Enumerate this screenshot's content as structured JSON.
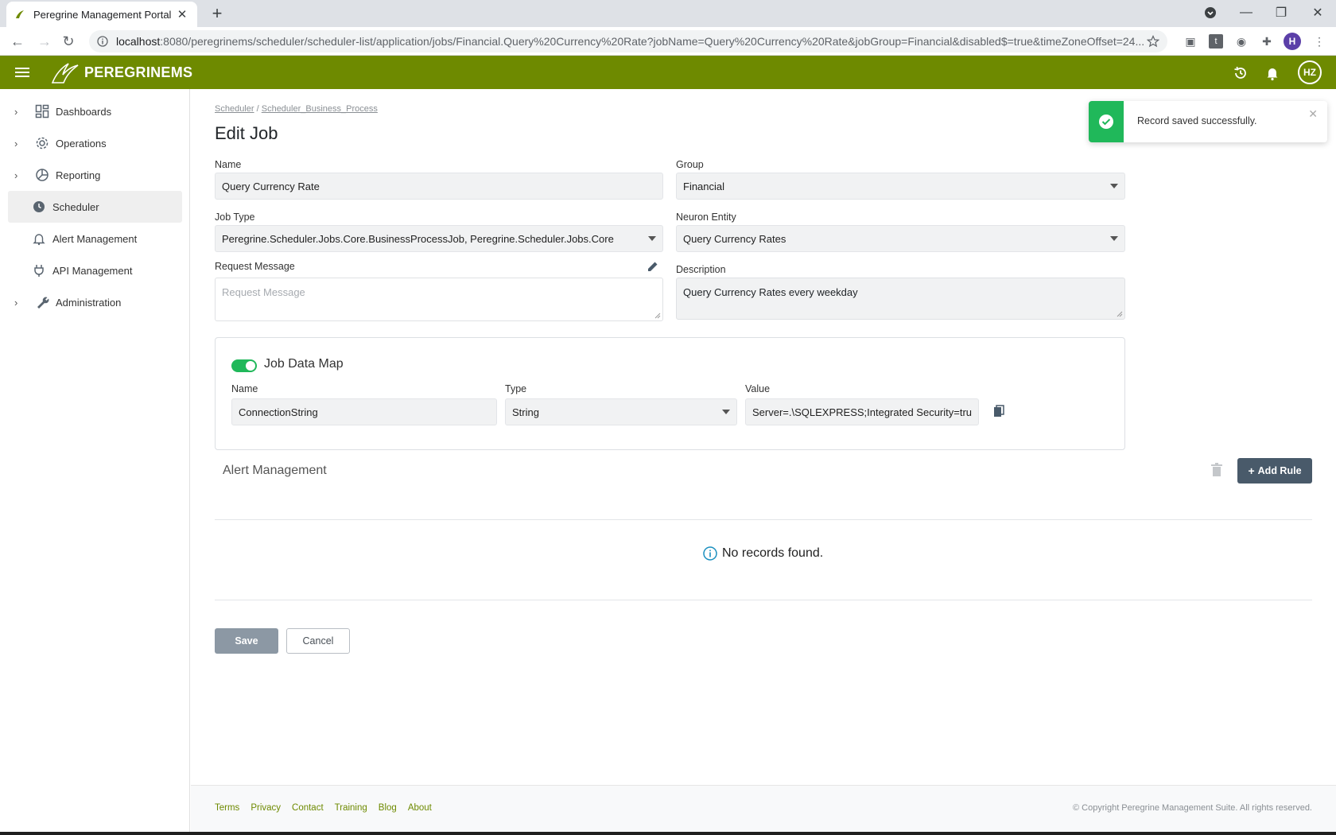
{
  "browser": {
    "tab_title": "Peregrine Management Portal",
    "url_host": "localhost",
    "url_rest": ":8080/peregrinems/scheduler/scheduler-list/application/jobs/Financial.Query%20Currency%20Rate?jobName=Query%20Currency%20Rate&jobGroup=Financial&disabled$=true&timeZoneOffset=24...",
    "profile_initial": "H"
  },
  "header": {
    "logo_text": "PEREGRINEMS",
    "avatar_initials": "HZ",
    "accent_color": "#6e8a00"
  },
  "sidebar": {
    "items": [
      {
        "label": "Dashboards",
        "icon": "dashboard-icon",
        "expandable": true
      },
      {
        "label": "Operations",
        "icon": "gear-icon",
        "expandable": true
      },
      {
        "label": "Reporting",
        "icon": "pie-chart-icon",
        "expandable": true
      },
      {
        "label": "Scheduler",
        "icon": "clock-icon",
        "expandable": false,
        "active": true
      },
      {
        "label": "Alert Management",
        "icon": "bell-icon",
        "expandable": false
      },
      {
        "label": "API Management",
        "icon": "plug-icon",
        "expandable": false
      },
      {
        "label": "Administration",
        "icon": "wrench-icon",
        "expandable": true
      }
    ]
  },
  "breadcrumb": {
    "root": "Scheduler",
    "separator": "/",
    "current": "Scheduler_Business_Process"
  },
  "page": {
    "title": "Edit Job"
  },
  "form": {
    "name_label": "Name",
    "name_value": "Query Currency Rate",
    "group_label": "Group",
    "group_value": "Financial",
    "job_type_label": "Job Type",
    "job_type_value": "Peregrine.Scheduler.Jobs.Core.BusinessProcessJob, Peregrine.Scheduler.Jobs.Core",
    "neuron_entity_label": "Neuron Entity",
    "neuron_entity_value": "Query Currency Rates",
    "request_message_label": "Request Message",
    "request_message_placeholder": "Request Message",
    "description_label": "Description",
    "description_value": "Query Currency Rates every weekday"
  },
  "job_data_map": {
    "title": "Job Data Map",
    "enabled": true,
    "name_label": "Name",
    "type_label": "Type",
    "value_label": "Value",
    "name_value": "ConnectionString",
    "type_value": "String",
    "value_value": "Server=.\\SQLEXPRESS;Integrated Security=true"
  },
  "alert_management": {
    "title": "Alert Management",
    "add_rule_label": "Add Rule",
    "empty_message": "No records found."
  },
  "actions": {
    "save_label": "Save",
    "cancel_label": "Cancel"
  },
  "footer": {
    "links": [
      "Terms",
      "Privacy",
      "Contact",
      "Training",
      "Blog",
      "About"
    ],
    "copyright": "© Copyright Peregrine Management Suite. All rights reserved."
  },
  "toast": {
    "message": "Record saved successfully.",
    "status_color": "#20b85a"
  }
}
